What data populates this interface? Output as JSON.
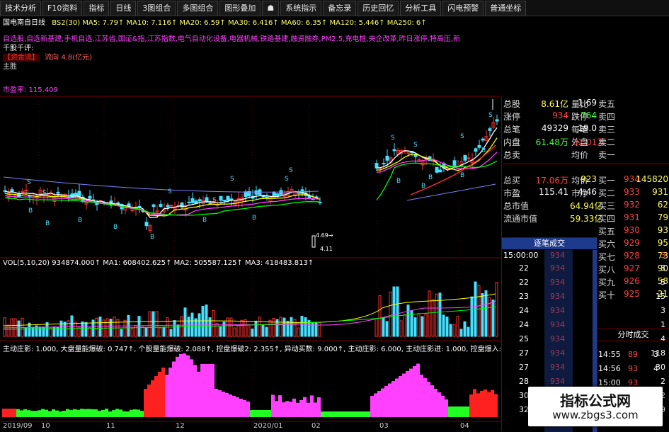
{
  "toolbar": [
    "技术分析",
    "F10资料",
    "指标",
    "日线",
    "3图组合",
    "多图组合",
    "图形叠加",
    "☗",
    "系统指示",
    "备忘录",
    "历史回忆",
    "分析工具",
    "闪电预警",
    "普通坐标"
  ],
  "header": {
    "title": "国电南自日线",
    "ma_line": "BS2(30) MA5: 7.79↑ MA10: 7.116↑ MA20: 6.59↑ MA30: 6.416↑ MA60: 6.35↑ MA120: 5.446↑ MA250: 6↑",
    "concepts": "自选股,自选新基建,手机自选,江苏省,国证&指,江苏指数,电气自动化设备,电器机械,铁路基建,融资融券,PM2.5,充电桩,央企改革,昨日涨停,特高压,新",
    "comment_label": "千股千评:",
    "tag_label": "【资金流】",
    "tag_value": "流向 4.8(亿元)",
    "extra": "主胜",
    "cost_label": "市盈率: 115.409"
  },
  "volume_header": "VOL(5,10,20) 934874.000↑ MA1: 608402.625↑ MA2: 505587.125↑ MA3: 418483.813↑",
  "indicator_header": "主动庄影: 1.000, 大盘量能爆破: 0.747↑, 个股量能爆破: 2.088↑, 控盘爆破2: 2.355↑, 异动买数: 9.000↑, 主动庄影: 6.000, 主动庄影进: 1.000, 控盘爆入: 庄影爆入进:",
  "date_axis": [
    "2019/09",
    "10",
    "11",
    "12",
    "2020/01",
    "02",
    "03",
    "04"
  ],
  "chart_text": {
    "s_markers": [
      "S",
      "S",
      "S",
      "S",
      "S",
      "S",
      "S",
      "S",
      "S",
      "S",
      "S",
      "S"
    ],
    "b_markers": [
      "B",
      "B",
      "B",
      "B",
      "B",
      "B",
      "B",
      "B",
      "B",
      "B",
      "B",
      "B"
    ],
    "low_note1": "4.69→",
    "low_note2": "4.11"
  },
  "stats": [
    {
      "k1": "总股",
      "v1": "8.61亿",
      "c1": "#ffff55",
      "k2": "量比",
      "v2": "1.69",
      "c2": "#ffffff",
      "side": "卖五"
    },
    {
      "k1": "涨停",
      "v1": "934",
      "c1": "#ff4040",
      "k2": "跌停",
      "v2": "764",
      "c2": "#40ff40",
      "side": "卖四"
    },
    {
      "k1": "总笔",
      "v1": "49329",
      "c1": "#ffffff",
      "k2": "每笔",
      "v2": "19.0",
      "c2": "#ffffff",
      "side": "卖三"
    },
    {
      "k1": "内盘",
      "v1": "61.48万",
      "c1": "#40ff40",
      "k2": "外盘",
      "v2": "32.01万",
      "c2": "#ff4040",
      "side": "卖二"
    },
    {
      "k1": "总卖",
      "v1": "",
      "c1": "#ffffff",
      "k2": "均价",
      "v2": "",
      "c2": "#ffffff",
      "side": "卖一"
    }
  ],
  "stats2": [
    {
      "k1": "总买",
      "v1": "17.06万",
      "c1": "#ff4040",
      "k2": "均价",
      "v2": "923",
      "c2": "#ffff55"
    },
    {
      "k1": "市盈",
      "v1": "115.41",
      "c1": "#ffffff",
      "k2": "市净",
      "v2": "4.46",
      "c2": "#ffffff"
    },
    {
      "k1": "总市值",
      "v1": "",
      "c1": "#ffffff",
      "k2": "",
      "v2": "64.94亿",
      "c2": "#ffff55"
    },
    {
      "k1": "流通市值",
      "v1": "",
      "c1": "#ffffff",
      "k2": "",
      "v2": "59.33亿",
      "c2": "#ffff55"
    }
  ],
  "buy_levels": [
    {
      "name": "买一",
      "price": "934",
      "vol": "145820"
    },
    {
      "name": "买二",
      "price": "933",
      "vol": "931"
    },
    {
      "name": "买三",
      "price": "932",
      "vol": "62"
    },
    {
      "name": "买四",
      "price": "931",
      "vol": "79"
    },
    {
      "name": "买五",
      "price": "930",
      "vol": "93"
    },
    {
      "name": "买六",
      "price": "929",
      "vol": "95"
    },
    {
      "name": "买七",
      "price": "928",
      "vol": "73"
    },
    {
      "name": "买八",
      "price": "927",
      "vol": "90"
    },
    {
      "name": "买九",
      "price": "926",
      "vol": "58"
    },
    {
      "name": "买十",
      "price": "925",
      "vol": "21"
    }
  ],
  "ticks_title": "逐笔成交",
  "ticks_time": "15:00:00",
  "ticks": [
    {
      "t": "22",
      "p": "934",
      "v": "3"
    },
    {
      "t": "22",
      "p": "934",
      "v": "5"
    },
    {
      "t": "23",
      "p": "934",
      "v": "15"
    },
    {
      "t": "24",
      "p": "934",
      "v": "3"
    },
    {
      "t": "24",
      "p": "934",
      "v": "1"
    },
    {
      "t": "25",
      "p": "934",
      "v": "4"
    },
    {
      "t": "27",
      "p": "934",
      "v": "118"
    },
    {
      "t": "27",
      "p": "934",
      "v": "30"
    },
    {
      "t": "28",
      "p": "934",
      "v": "2"
    },
    {
      "t": "30",
      "p": "934",
      "v": "2"
    },
    {
      "t": "32",
      "p": "934",
      "v": "9"
    }
  ],
  "fenshi_title": "分时成交",
  "fenshi": [
    {
      "t": "14:55",
      "p": "89",
      "v": "3"
    },
    {
      "t": "14:56",
      "p": "93",
      "v": "4"
    },
    {
      "t": "15:00",
      "p": "93",
      "v": ""
    }
  ],
  "watermark": {
    "line1": "指标公式网",
    "line2": "www.zbgs3.com"
  },
  "colors": {
    "up": "#ff3030",
    "down": "#44e0ff",
    "ma5": "#ffffff",
    "ma10": "#ffff00",
    "ma20": "#ff40ff",
    "ma30": "#00ff00"
  }
}
